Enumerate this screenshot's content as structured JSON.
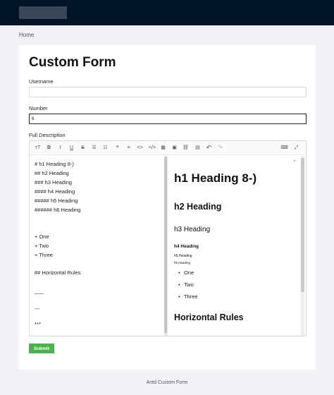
{
  "breadcrumb": "Home",
  "form": {
    "title": "Custom Form",
    "username_label": "Username",
    "username_value": "",
    "number_label": "Number",
    "number_value": "6",
    "description_label": "Full Description",
    "submit_label": "Submit"
  },
  "toolbar": {
    "icons": [
      "heading-icon",
      "bold-icon",
      "italic-icon",
      "underline-icon",
      "strikethrough-icon",
      "unordered-list-icon",
      "ordered-list-icon",
      "quote-icon",
      "hr-icon",
      "code-icon",
      "code-block-icon",
      "table-icon",
      "image-icon",
      "link-icon",
      "clipboard-icon",
      "undo-icon",
      "redo-icon",
      "keyboard-icon",
      "fullscreen-icon"
    ],
    "glyphs": [
      "ᴛT",
      "B",
      "I",
      "U",
      "S",
      "☰",
      "☷",
      "❝",
      "≡",
      "<>",
      "</>",
      "▦",
      "▣",
      "⛓",
      "▤",
      "↶",
      "↷",
      "⌨",
      "⤢"
    ]
  },
  "editor": {
    "source_lines": [
      "# h1 Heading 8-)",
      "## h2 Heading",
      "### h3 Heading",
      "#### h4 Heading",
      "##### h5 Heading",
      "###### h6 Heading",
      "",
      "",
      "+ One",
      "+ Two",
      "+ Three",
      "",
      "## Horizontal Rules",
      "",
      "___",
      "",
      "---",
      "",
      "***"
    ],
    "preview": {
      "h1": "h1 Heading 8-)",
      "h2": "h2 Heading",
      "h3": "h3 Heading",
      "h4": "h4 Heading",
      "h5": "h5 Heading",
      "h6": "h6 Heading",
      "list": [
        "One",
        "Two",
        "Three"
      ],
      "h2_rules": "Horizontal Rules"
    }
  },
  "footer": "Antd Custom Form"
}
